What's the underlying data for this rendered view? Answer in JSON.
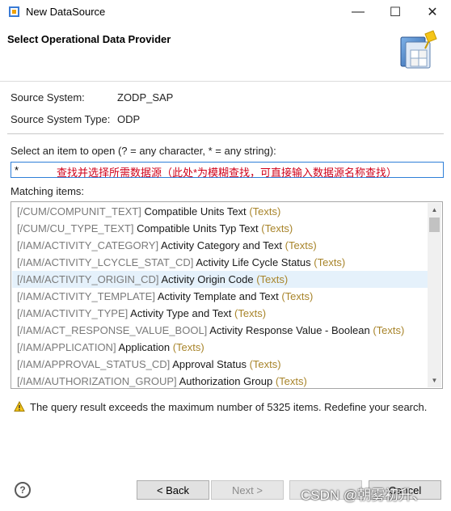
{
  "window": {
    "title": "New DataSource",
    "minimize_glyph": "—",
    "maximize_glyph": "☐",
    "close_glyph": "✕"
  },
  "header": {
    "title": "Select Operational Data Provider",
    "image_icon": "datasource-wizard-icon"
  },
  "fields": {
    "source_system_label": "Source System:",
    "source_system_value": "ZODP_SAP",
    "source_system_type_label": "Source System Type:",
    "source_system_type_value": "ODP"
  },
  "search": {
    "label": "Select an item to open (? = any character, * = any string):",
    "value": "*",
    "annotation": "查找并选择所需数据源（此处*为模糊查找，可直接输入数据源名称查找）"
  },
  "matching": {
    "label": "Matching items:",
    "items": [
      {
        "tech": "[/CUM/COMPUNIT_TEXT]",
        "desc": "Compatible Units Text",
        "kind": "(Texts)"
      },
      {
        "tech": "[/CUM/CU_TYPE_TEXT]",
        "desc": "Compatible Units Typ Text",
        "kind": "(Texts)"
      },
      {
        "tech": "[/IAM/ACTIVITY_CATEGORY]",
        "desc": "Activity Category and Text",
        "kind": "(Texts)"
      },
      {
        "tech": "[/IAM/ACTIVITY_LCYCLE_STAT_CD]",
        "desc": "Activity Life Cycle Status",
        "kind": "(Texts)"
      },
      {
        "tech": "[/IAM/ACTIVITY_ORIGIN_CD]",
        "desc": "Activity Origin Code",
        "kind": "(Texts)"
      },
      {
        "tech": "[/IAM/ACTIVITY_TEMPLATE]",
        "desc": "Activity Template and Text",
        "kind": "(Texts)"
      },
      {
        "tech": "[/IAM/ACTIVITY_TYPE]",
        "desc": "Activity Type and Text",
        "kind": "(Texts)"
      },
      {
        "tech": "[/IAM/ACT_RESPONSE_VALUE_BOOL]",
        "desc": "Activity Response Value - Boolean",
        "kind": "(Texts)"
      },
      {
        "tech": "[/IAM/APPLICATION]",
        "desc": "Application",
        "kind": "(Texts)"
      },
      {
        "tech": "[/IAM/APPROVAL_STATUS_CD]",
        "desc": "Approval Status",
        "kind": "(Texts)"
      },
      {
        "tech": "[/IAM/AUTHORIZATION_GROUP]",
        "desc": "Authorization Group",
        "kind": "(Texts)"
      }
    ]
  },
  "warning": {
    "icon": "warning-icon",
    "text": "The query result exceeds the maximum number of 5325 items. Redefine your search."
  },
  "footer": {
    "help_glyph": "?",
    "back_label": "< Back",
    "next_label": "Next >",
    "cancel_label": "Cancel"
  },
  "watermark": "CSDN @朝雾初升、",
  "colors": {
    "accent_border": "#2f7fd8",
    "annotation_red": "#d0021b",
    "selected_row": "#e5f1fb",
    "type_suffix": "#a8842a"
  }
}
